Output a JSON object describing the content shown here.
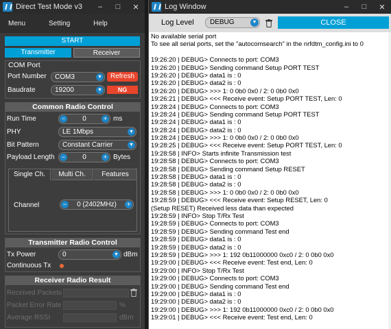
{
  "dtm": {
    "title": "Direct Test Mode v3",
    "menu": [
      "Menu",
      "Setting",
      "Help"
    ],
    "start_label": "START",
    "tabs": {
      "transmitter": "Transmitter",
      "receiver": "Receiver"
    },
    "com_port": {
      "heading": "COM Port",
      "port_label": "Port Number",
      "port_value": "COM3",
      "refresh_label": "Refresh",
      "baud_label": "Baudrate",
      "baud_value": "19200",
      "status_badge": "NG"
    },
    "common": {
      "heading": "Common Radio Control",
      "run_time_label": "Run Time",
      "run_time_value": "0",
      "run_time_unit": "ms",
      "phy_label": "PHY",
      "phy_value": "LE 1Mbps",
      "bit_pattern_label": "Bit Pattern",
      "bit_pattern_value": "Constant Carrier",
      "payload_label": "Payload Length",
      "payload_value": "0",
      "payload_unit": "Bytes",
      "subtabs": [
        "Single Ch.",
        "Multi Ch.",
        "Features"
      ],
      "channel_label": "Channel",
      "channel_value": "0 (2402MHz)"
    },
    "tx": {
      "heading": "Transmitter Radio Control",
      "tx_power_label": "Tx Power",
      "tx_power_value": "0",
      "tx_power_unit": "dBm",
      "continuous_label": "Continuous Tx"
    },
    "rx": {
      "heading": "Receiver Radio Result",
      "received_label": "Received Packets",
      "per_label": "Packet Error Rate",
      "per_unit": "%",
      "rssi_label": "Average RSSI",
      "rssi_unit": "dBm"
    }
  },
  "log": {
    "title": "Log Window",
    "level_label": "Log Level",
    "level_value": "DEBUG",
    "close_label": "CLOSE",
    "lines": [
      "No available serial port",
      "To see all serial ports, set the \"autocomsearch\" in the nrfdtm_config.ini to 0",
      "",
      "19:26:20 | DEBUG> Connects to port: COM3",
      "19:26:20 | DEBUG> Sending command Setup PORT TEST",
      "19:26:20 | DEBUG> data1 is : 0",
      "19:26:20 | DEBUG> data2 is : 0",
      "19:26:20 | DEBUG> >>> 1: 0 0b0 0x0 / 2: 0 0b0 0x0",
      "19:26:21 | DEBUG> <<< Receive event: Setup PORT TEST, Len: 0",
      "19:28:24 | DEBUG> Connects to port: COM3",
      "19:28:24 | DEBUG> Sending command Setup PORT TEST",
      "19:28:24 | DEBUG> data1 is : 0",
      "19:28:24 | DEBUG> data2 is : 0",
      "19:28:24 | DEBUG> >>> 1: 0 0b0 0x0 / 2: 0 0b0 0x0",
      "19:28:25 | DEBUG> <<< Receive event: Setup PORT TEST, Len: 0",
      "19:28:58 | INFO> Starts infinite Transmission test",
      "19:28:58 | DEBUG> Connects to port: COM3",
      "19:28:58 | DEBUG> Sending command Setup RESET",
      "19:28:58 | DEBUG> data1 is : 0",
      "19:28:58 | DEBUG> data2 is : 0",
      "19:28:58 | DEBUG> >>> 1: 0 0b0 0x0 / 2: 0 0b0 0x0",
      "19:28:59 | DEBUG> <<< Receive event: Setup RESET, Len: 0",
      "(Setup RESET) Received less data than expected",
      "19:28:59 | INFO> Stop T/Rx Test",
      "19:28:59 | DEBUG> Connects to port: COM3",
      "19:28:59 | DEBUG> Sending command Test end",
      "19:28:59 | DEBUG> data1 is : 0",
      "19:28:59 | DEBUG> data2 is : 0",
      "19:28:59 | DEBUG> >>> 1: 192 0b11000000 0xc0 / 2: 0 0b0 0x0",
      "19:29:00 | DEBUG> <<< Receive event: Test end, Len: 0",
      "19:29:00 | INFO> Stop T/Rx Test",
      "19:29:00 | DEBUG> Connects to port: COM3",
      "19:29:00 | DEBUG> Sending command Test end",
      "19:29:00 | DEBUG> data1 is : 0",
      "19:29:00 | DEBUG> data2 is : 0",
      "19:29:00 | DEBUG> >>> 1: 192 0b11000000 0xc0 / 2: 0 0b0 0x0",
      "19:29:01 | DEBUG> <<< Receive event: Test end, Len: 0"
    ]
  },
  "colors": {
    "accent": "#00a0d7",
    "ng_badge": "#e8452c",
    "refresh_button": "#e8452c",
    "continuous_indicator": "#f06a35"
  },
  "icons": [
    "app-logo-icon",
    "minimize-icon",
    "maximize-icon",
    "close-icon",
    "chevron-down-icon",
    "trash-icon"
  ]
}
